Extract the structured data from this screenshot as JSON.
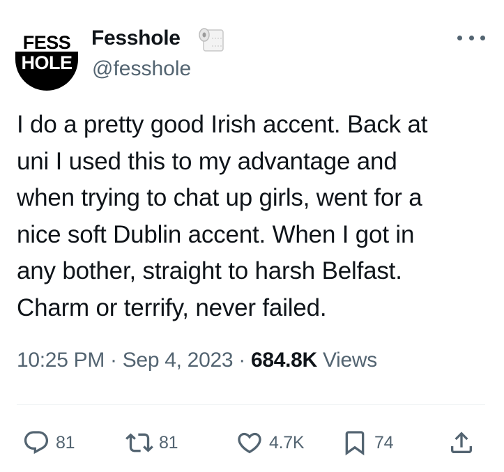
{
  "author": {
    "display_name": "Fesshole",
    "handle": "@fesshole",
    "avatar_text_top": "FESS",
    "avatar_text_bottom": "HOLE",
    "name_emoji": "toilet-paper-icon"
  },
  "tweet": {
    "text_lines": [
      "I do a pretty good Irish accent. Back at",
      "uni I used this to my advantage and",
      "when trying to chat up girls, went for a",
      "nice soft Dublin accent. When I got in",
      "any bother, straight to harsh Belfast.",
      "Charm or terrify, never failed."
    ],
    "time": "10:25 PM",
    "date": "Sep 4, 2023",
    "separator": "·",
    "views_count": "684.8K",
    "views_label": "Views"
  },
  "actions": {
    "replies": "81",
    "reposts": "81",
    "likes": "4.7K",
    "bookmarks": "74"
  },
  "icons": {
    "reply": "speech-bubble-icon",
    "repost": "repost-arrows-icon",
    "like": "heart-icon",
    "bookmark": "bookmark-icon",
    "share": "share-upload-icon",
    "more": "more-dots-icon"
  },
  "colors": {
    "text_primary": "#0f1419",
    "text_secondary": "#536471",
    "divider": "#eff3f4",
    "avatar_black": "#000000"
  }
}
